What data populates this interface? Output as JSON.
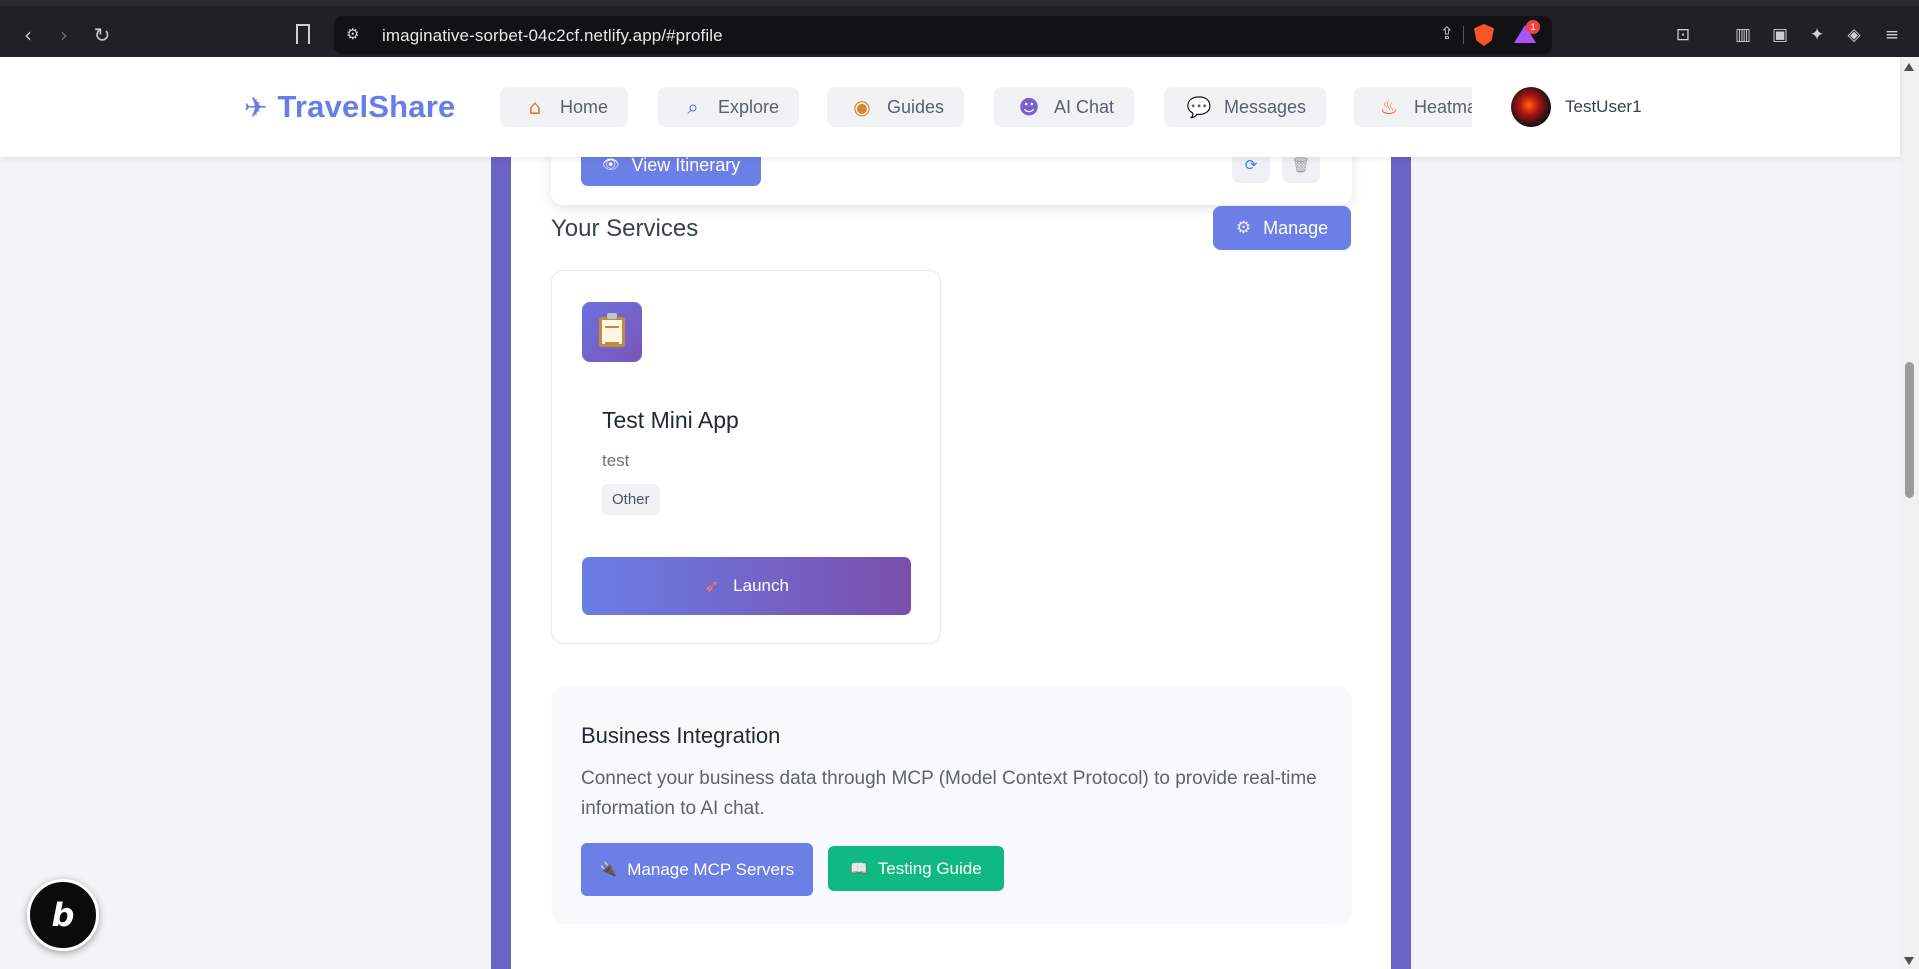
{
  "browser": {
    "url": "imaginative-sorbet-04c2cf.netlify.app/#profile",
    "badge_count": "1"
  },
  "header": {
    "brand": "TravelShare",
    "nav": [
      {
        "label": "Home",
        "icon": "home-icon"
      },
      {
        "label": "Explore",
        "icon": "search-icon"
      },
      {
        "label": "Guides",
        "icon": "compass-icon"
      },
      {
        "label": "AI Chat",
        "icon": "robot-icon"
      },
      {
        "label": "Messages",
        "icon": "speech-bubble-icon"
      },
      {
        "label": "Heatmap",
        "icon": "fire-icon"
      }
    ],
    "username": "TestUser1"
  },
  "itinerary": {
    "view_label": "View Itinerary"
  },
  "services": {
    "title": "Your Services",
    "manage_label": "Manage",
    "items": [
      {
        "name": "Test Mini App",
        "description": "test",
        "tag": "Other",
        "icon": "clipboard-icon",
        "launch_label": "Launch"
      }
    ]
  },
  "business": {
    "title": "Business Integration",
    "text": "Connect your business data through MCP (Model Context Protocol) to provide real-time information to AI chat.",
    "mcp_label": "Manage MCP Servers",
    "guide_label": "Testing Guide"
  },
  "colors": {
    "brand": "#667eea",
    "primary_button": "#6b7fe6",
    "success_button": "#10b981",
    "panel_purple": "#6c63c6"
  }
}
